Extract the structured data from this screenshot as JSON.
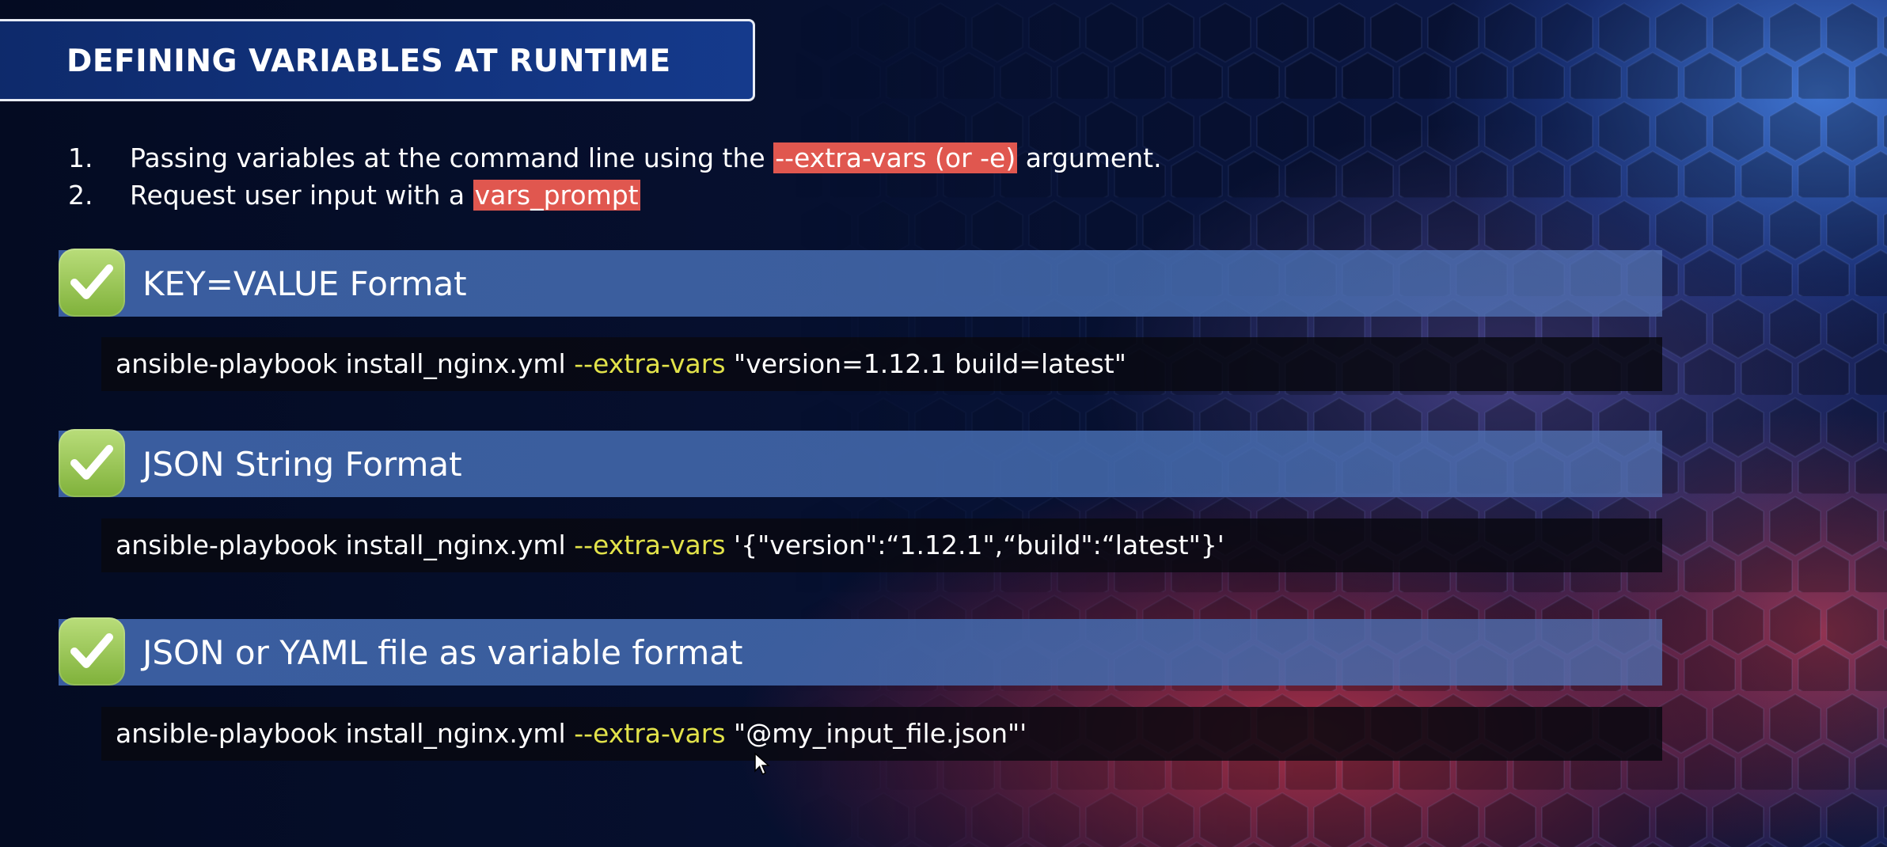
{
  "title": "DEFINING VARIABLES AT RUNTIME",
  "list": [
    {
      "number": "1.",
      "text_before": "Passing variables at the command line using the ",
      "highlight": "--extra-vars (or -e)",
      "text_after": " argument."
    },
    {
      "number": "2.",
      "text_before": "Request user input with a ",
      "highlight": "vars_prompt",
      "text_after": ""
    }
  ],
  "sections": [
    {
      "title": "KEY=VALUE Format",
      "cmd_prefix": "ansible-playbook install_nginx.yml ",
      "cmd_flag": "--extra-vars",
      "cmd_arg": " \"version=1.12.1 build=latest\""
    },
    {
      "title": "JSON String Format",
      "cmd_prefix": "ansible-playbook install_nginx.yml ",
      "cmd_flag": "--extra-vars",
      "cmd_arg": " '{\"version\":“1.12.1\",“build\":“latest\"}'"
    },
    {
      "title": "JSON or YAML file as variable format",
      "cmd_prefix": "ansible-playbook install_nginx.yml ",
      "cmd_flag": "--extra-vars",
      "cmd_arg": " \"@my_input_file.json\"'"
    }
  ],
  "colors": {
    "highlight": "#e0574f",
    "flag": "#e2e24a",
    "check": "#9cc95a",
    "section_bar": "#3e64aa",
    "title_box": "#123480"
  },
  "icons": {
    "check": "check-mark-icon",
    "cursor": "mouse-pointer-icon"
  }
}
